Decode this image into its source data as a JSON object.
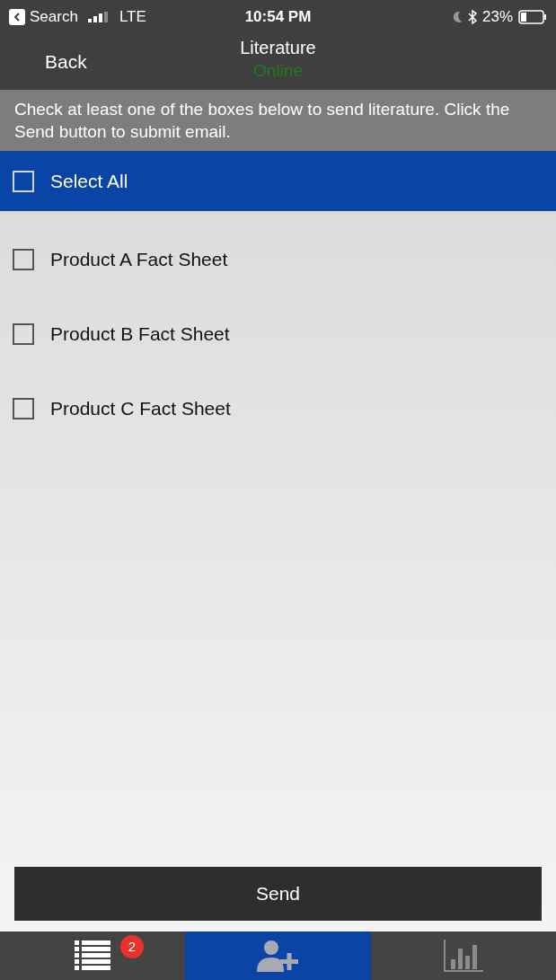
{
  "status_bar": {
    "back_label": "Search",
    "carrier": "LTE",
    "time": "10:54 PM",
    "battery": "23%"
  },
  "nav": {
    "back": "Back",
    "title": "Literature",
    "status": "Online"
  },
  "instructions": "Check at least one of the boxes below to send literature. Click the Send button to submit email.",
  "select_all": {
    "label": "Select All",
    "checked": false
  },
  "items": [
    {
      "label": "Product A Fact Sheet",
      "checked": false
    },
    {
      "label": "Product B Fact Sheet",
      "checked": false
    },
    {
      "label": "Product C Fact Sheet",
      "checked": false
    }
  ],
  "send_button": "Send",
  "tabs": [
    {
      "kind": "list",
      "selected": false,
      "badge": "2"
    },
    {
      "kind": "add-user",
      "selected": true
    },
    {
      "kind": "chart",
      "selected": false
    }
  ]
}
